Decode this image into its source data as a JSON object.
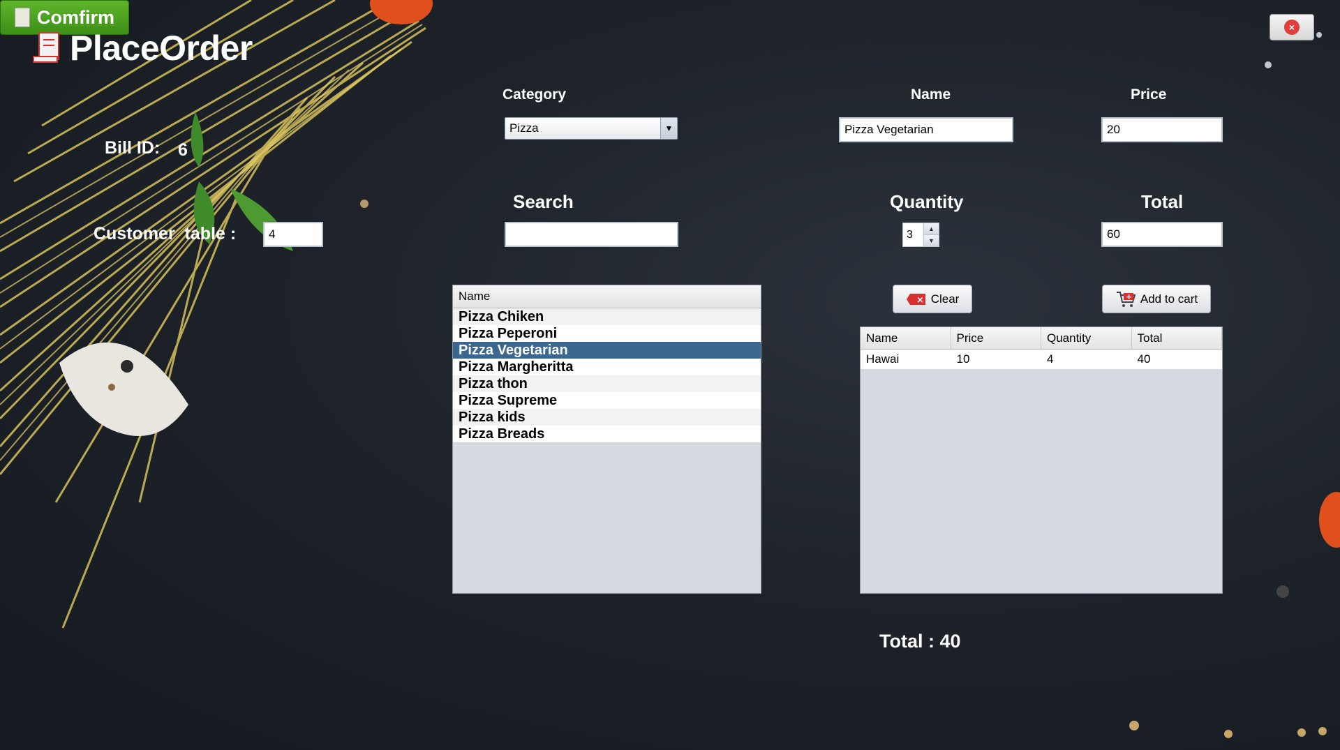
{
  "app": {
    "title": "PlaceOrder",
    "close_label": "×"
  },
  "bill": {
    "label": "Bill ID:",
    "value": "6"
  },
  "customer_table": {
    "label": "Customer  table :",
    "value": "4"
  },
  "category": {
    "label": "Category",
    "selected": "Pizza"
  },
  "name": {
    "label": "Name",
    "value": "Pizza Vegetarian"
  },
  "price": {
    "label": "Price",
    "value": "20"
  },
  "search": {
    "label": "Search",
    "value": ""
  },
  "quantity": {
    "label": "Quantity",
    "value": "3",
    "up": "▲",
    "down": "▼"
  },
  "total_field": {
    "label": "Total",
    "value": "60"
  },
  "product_list": {
    "header": "Name",
    "items": [
      "Pizza Chiken",
      "Pizza Peperoni",
      "Pizza Vegetarian",
      "Pizza Margheritta",
      "Pizza thon",
      "Pizza Supreme",
      "Pizza kids",
      "Pizza Breads"
    ],
    "selected_index": 2
  },
  "buttons": {
    "clear": "Clear",
    "add_to_cart": "Add to cart",
    "confirm": "Comfirm"
  },
  "cart": {
    "columns": [
      "Name",
      "Price",
      "Quantity",
      "Total"
    ],
    "rows": [
      [
        "Hawai",
        "10",
        "4",
        "40"
      ]
    ]
  },
  "grand_total": "Total : 40",
  "colors": {
    "selected_row": "#3a6690",
    "confirm": "#4ea020",
    "close": "#e23c3c"
  }
}
